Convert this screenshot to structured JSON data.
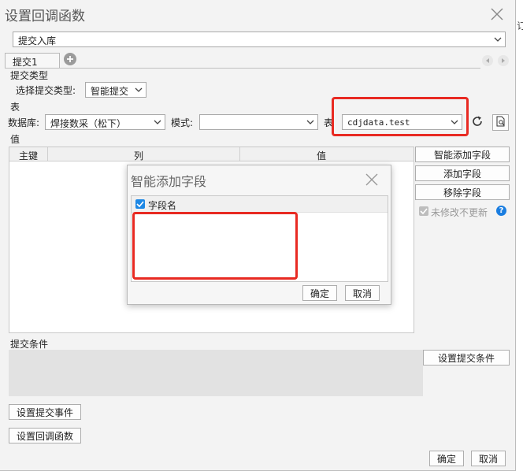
{
  "window": {
    "title": "设置回调函数"
  },
  "action_select": {
    "value": "提交入库"
  },
  "tabs": [
    {
      "label": "提交1"
    }
  ],
  "submit_type": {
    "section_label": "提交类型",
    "field_label": "选择提交类型:",
    "value": "智能提交"
  },
  "table_section": {
    "section_label": "表",
    "database_label": "数据库:",
    "database_value": "焊接数采（松下）",
    "mode_label": "模式:",
    "mode_value": "",
    "table_label": "表",
    "table_value": "cdjdata.test"
  },
  "values_section": {
    "section_label": "值",
    "columns": [
      "主键",
      "列",
      "值"
    ]
  },
  "side_buttons": {
    "smart_add": "智能添加字段",
    "add_field": "添加字段",
    "remove_field": "移除字段",
    "no_update_label": "未修改不更新",
    "help": "?"
  },
  "dialog": {
    "title": "智能添加字段",
    "column_header": "字段名",
    "ok": "确定",
    "cancel": "取消"
  },
  "conditions": {
    "section_label": "提交条件",
    "set_button": "设置提交条件"
  },
  "bottom": {
    "submit_event": "设置提交事件",
    "callback": "设置回调函数",
    "ok": "确定",
    "cancel": "取消"
  },
  "background": {
    "edge_text": "订"
  },
  "colors": {
    "highlight": "#e82a22",
    "checkbox": "#1e88e5",
    "help": "#1a7de0"
  }
}
